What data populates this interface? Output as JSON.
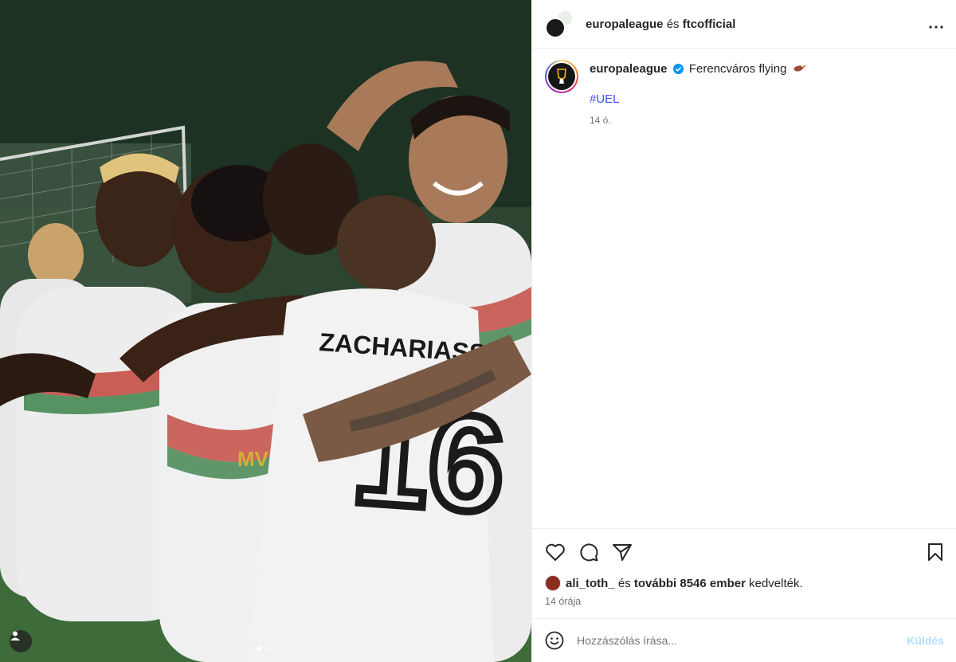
{
  "post": {
    "image_alt": "Ferencváros players celebrating",
    "jersey_name": "ZACHARIASS",
    "jersey_number": "16",
    "sponsor": "MVM",
    "carousel": {
      "count": 2,
      "active": 1
    }
  },
  "header": {
    "user1": "europaleague",
    "connector": "és",
    "user2": "ftcofficial",
    "more_icon": "more-horizontal-icon"
  },
  "caption": {
    "username": "europaleague",
    "text": "Ferencváros flying",
    "emoji": "eagle",
    "hashtag": "#UEL",
    "time": "14 ó."
  },
  "actions": {
    "like_icon": "heart-icon",
    "comment_icon": "comment-icon",
    "share_icon": "send-icon",
    "save_icon": "bookmark-icon"
  },
  "likes": {
    "user": "ali_toth_",
    "connector": "és",
    "others": "további 8546 ember",
    "suffix": "kedvelték."
  },
  "post_time": "14 órája",
  "comment": {
    "placeholder": "Hozzászólás írása...",
    "value": "",
    "send_label": "Küldés"
  },
  "colors": {
    "hashtag": "#4150f7",
    "send_disabled": "#b2dffc",
    "verified": "#0095f6",
    "divider": "#efefef"
  }
}
